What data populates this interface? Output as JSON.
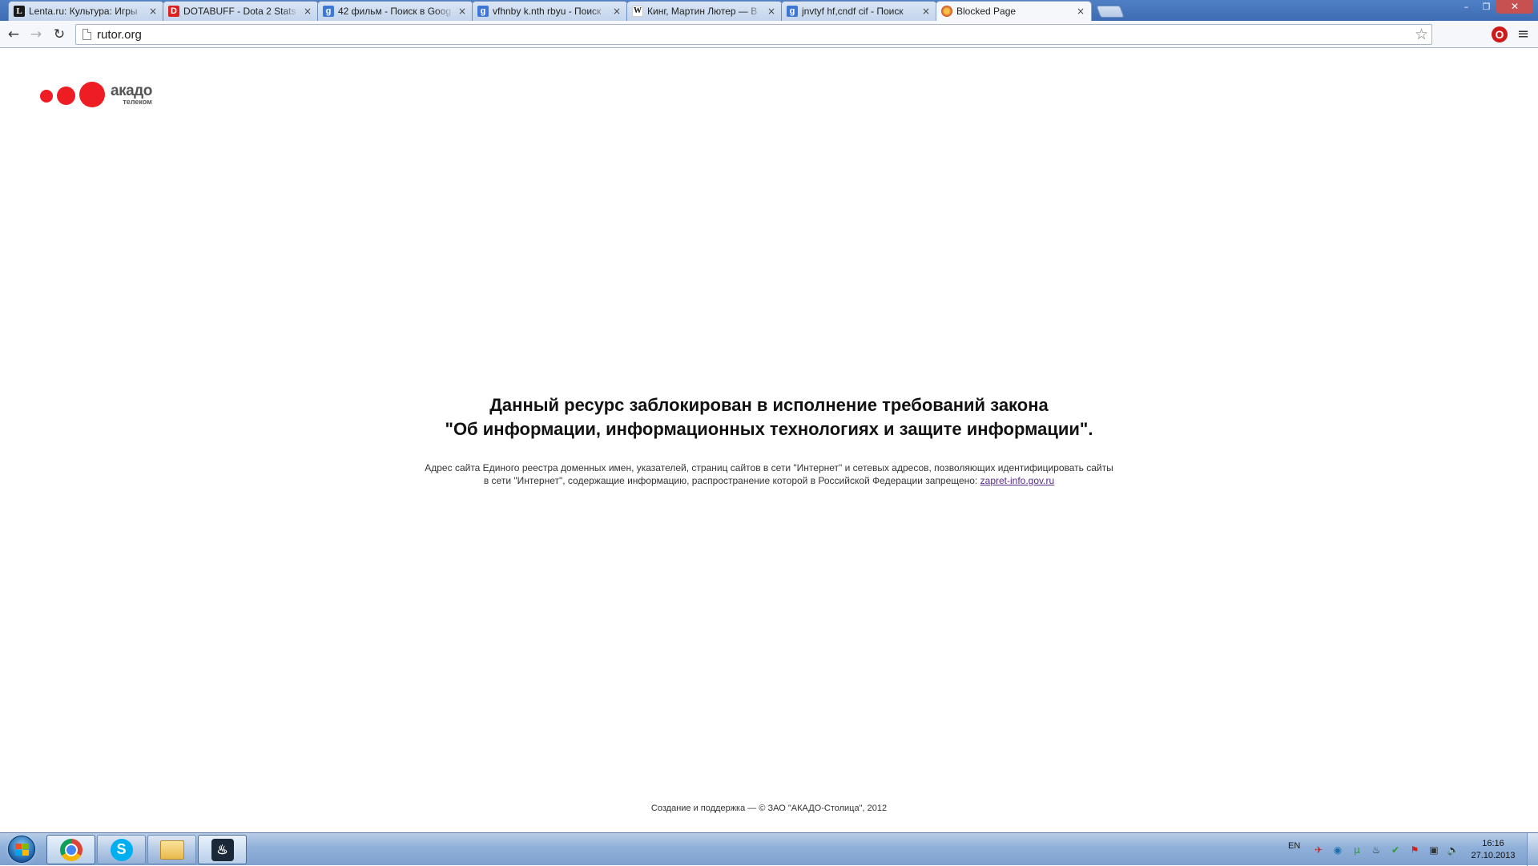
{
  "browser": {
    "tabs": [
      {
        "favicon": "L",
        "favicon_class": "fav-lenta",
        "title": "Lenta.ru: Культура: Игры",
        "close": "×"
      },
      {
        "favicon": "D",
        "favicon_class": "fav-dota",
        "title": "DOTABUFF - Dota 2 Stats",
        "close": "×"
      },
      {
        "favicon": "g",
        "favicon_class": "fav-google",
        "title": "42 фильм - Поиск в Goog",
        "close": "×"
      },
      {
        "favicon": "g",
        "favicon_class": "fav-google",
        "title": "vfhnby k.nth rbyu - Поиск",
        "close": "×"
      },
      {
        "favicon": "W",
        "favicon_class": "fav-wiki",
        "title": "Кинг, Мартин Лютер — В",
        "close": "×"
      },
      {
        "favicon": "g",
        "favicon_class": "fav-google",
        "title": "jnvtyf hf,cndf cif - Поиск",
        "close": "×"
      },
      {
        "favicon": "",
        "favicon_class": "fav-blocked",
        "title": "Blocked Page",
        "close": "×"
      }
    ],
    "active_tab_index": 6,
    "window_controls": {
      "minimize": "–",
      "maximize": "❐",
      "close": "✕"
    },
    "toolbar": {
      "back": "←",
      "forward": "→",
      "reload": "↻",
      "url": "rutor.org",
      "star": "☆",
      "opera": "O",
      "menu": "≡"
    }
  },
  "page": {
    "logo": {
      "word": "акадо",
      "sub": "телеком",
      "color": "#ee1d23"
    },
    "headline_line1": "Данный ресурс заблокирован в исполнение требований закона",
    "headline_line2": "\"Об информации, информационных технологиях и защите информации\".",
    "notice_line1": "Адрес сайта Единого реестра доменных имен, указателей, страниц сайтов в сети \"Интернет\" и сетевых адресов, позволяющих идентифицировать сайты",
    "notice_line2": "в сети \"Интернет\", содержащие информацию, распространение которой в Российской Федерации запрещено:",
    "notice_link": "zapret-info.gov.ru",
    "footer": "Создание и поддержка — © ЗАО \"АКАДО-Столица\", 2012"
  },
  "taskbar": {
    "apps": [
      {
        "name": "chrome",
        "label": ""
      },
      {
        "name": "skype",
        "label": "S"
      },
      {
        "name": "explorer",
        "label": ""
      },
      {
        "name": "steam",
        "label": "♨"
      }
    ],
    "language": "EN",
    "tray_icons": [
      {
        "name": "tray-app-icon-1",
        "glyph": "✈",
        "cls": "ti-red"
      },
      {
        "name": "tray-app-icon-2",
        "glyph": "◉",
        "cls": "ti-blue"
      },
      {
        "name": "utorrent-icon",
        "glyph": "µ",
        "cls": "ti-green"
      },
      {
        "name": "steam-tray-icon",
        "glyph": "♨",
        "cls": "ti-dark"
      },
      {
        "name": "security-check-icon",
        "glyph": "✔",
        "cls": "ti-green"
      },
      {
        "name": "action-center-icon",
        "glyph": "⚑",
        "cls": "ti-red"
      },
      {
        "name": "network-icon",
        "glyph": "▣",
        "cls": "ti-dark"
      },
      {
        "name": "volume-icon",
        "glyph": "🔈",
        "cls": "ti-dark"
      }
    ],
    "time": "16:16",
    "date": "27.10.2013"
  }
}
